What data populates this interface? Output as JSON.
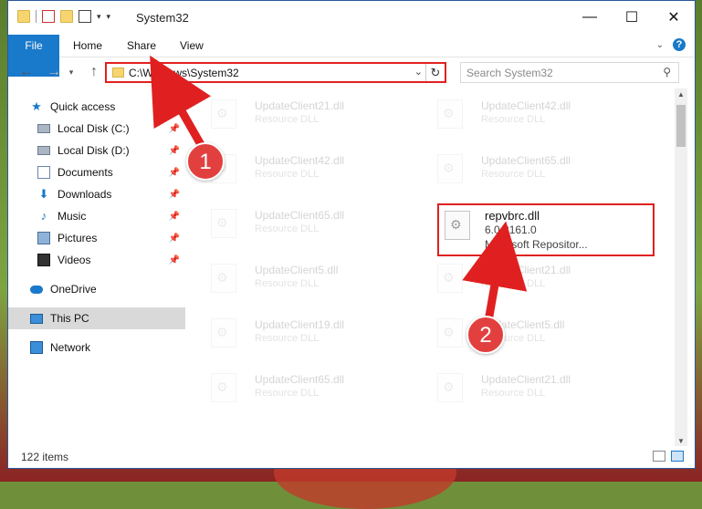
{
  "window": {
    "title": "System32",
    "controls": {
      "minimize": "—",
      "maximize": "☐",
      "close": "✕"
    }
  },
  "ribbon": {
    "tabs": [
      "File",
      "Home",
      "Share",
      "View"
    ]
  },
  "address": {
    "path": "C:\\Windows\\System32",
    "search_placeholder": "Search System32"
  },
  "sidebar": {
    "items": [
      {
        "label": "Quick access",
        "icon": "star-icon",
        "pinned": false
      },
      {
        "label": "Local Disk (C:)",
        "icon": "drive-icon",
        "pinned": true
      },
      {
        "label": "Local Disk (D:)",
        "icon": "drive-icon",
        "pinned": true
      },
      {
        "label": "Documents",
        "icon": "documents-icon",
        "pinned": true
      },
      {
        "label": "Downloads",
        "icon": "download-icon",
        "pinned": true
      },
      {
        "label": "Music",
        "icon": "music-icon",
        "pinned": true
      },
      {
        "label": "Pictures",
        "icon": "pictures-icon",
        "pinned": true
      },
      {
        "label": "Videos",
        "icon": "videos-icon",
        "pinned": true
      },
      {
        "label": "OneDrive",
        "icon": "cloud-icon",
        "pinned": false
      },
      {
        "label": "This PC",
        "icon": "computer-icon",
        "pinned": false,
        "selected": true
      },
      {
        "label": "Network",
        "icon": "network-icon",
        "pinned": false
      }
    ]
  },
  "files": {
    "left": [
      {
        "name": "UpdateClient21.dll",
        "type": "Resource DLL"
      },
      {
        "name": "UpdateClient42.dll",
        "type": "Resource DLL"
      },
      {
        "name": "UpdateClient65.dll",
        "type": "Resource DLL"
      },
      {
        "name": "UpdateClient5.dll",
        "type": "Resource DLL"
      },
      {
        "name": "UpdateClient19.dll",
        "type": "Resource DLL"
      },
      {
        "name": "UpdateClient65.dll",
        "type": "Resource DLL"
      }
    ],
    "right": [
      {
        "name": "UpdateClient42.dll",
        "type": "Resource DLL"
      },
      {
        "name": "UpdateClient65.dll",
        "type": "Resource DLL"
      },
      {
        "name": "UpdateClient21.dll",
        "type": "Resource DLL"
      },
      {
        "name": "UpdateClient5.dll",
        "type": "Resource DLL"
      },
      {
        "name": "UpdateClient21.dll",
        "type": "Resource DLL"
      }
    ],
    "highlighted": {
      "name": "repvbrc.dll",
      "version": "6.0.8161.0",
      "company": "Microsoft Repositor..."
    }
  },
  "status": {
    "count": "122 items"
  },
  "annotations": {
    "step1": "1",
    "step2": "2",
    "accent": "#e02020"
  }
}
